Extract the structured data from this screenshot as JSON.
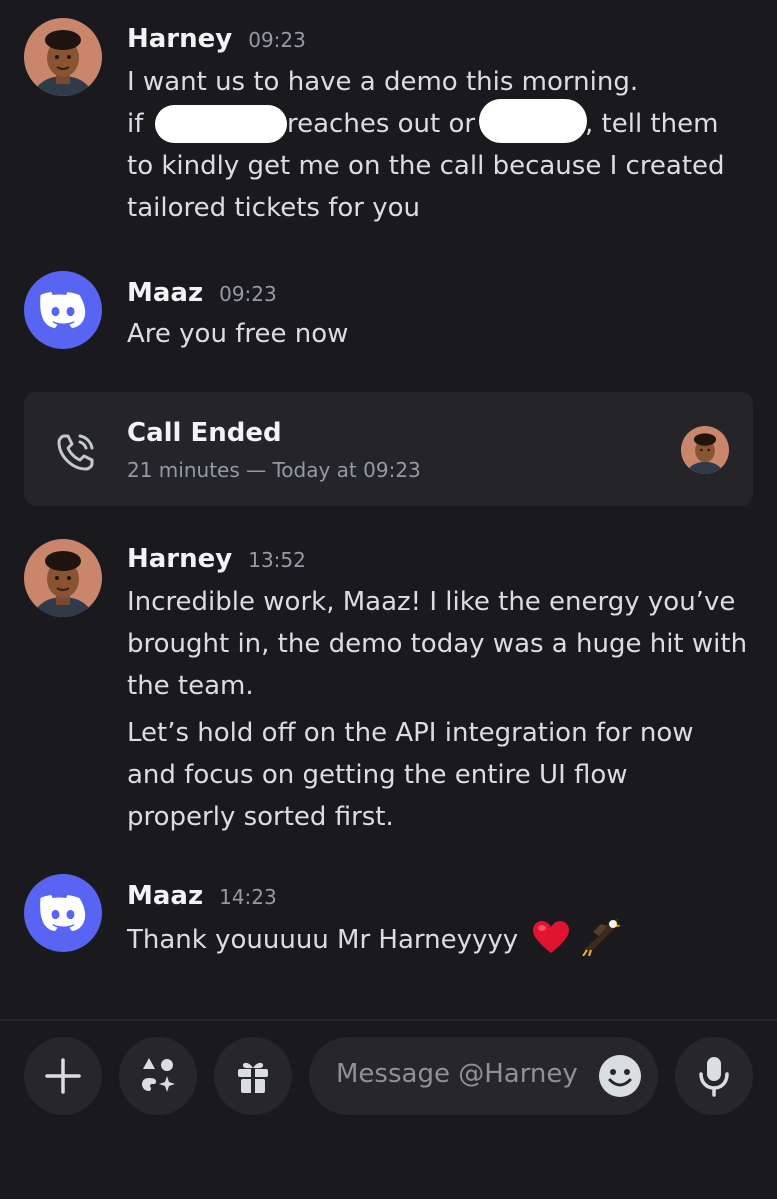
{
  "messages": [
    {
      "author": "Harney",
      "time": "09:23",
      "lines": [
        "I want us to have a demo this morning.",
        "if",
        "reaches out or",
        ", tell them",
        "to kindly get me on the call because I created",
        "tailored tickets for you"
      ]
    },
    {
      "author": "Maaz",
      "time": "09:23",
      "text": "Are you free now"
    },
    {
      "author": "Harney",
      "time": "13:52",
      "paragraph1": [
        "Incredible work, Maaz! I like the energy you’ve",
        "brought in, the demo today was a huge hit with",
        "the team."
      ],
      "paragraph2": [
        "Let’s hold off on the API integration for now",
        "and focus on getting the entire UI flow",
        "properly sorted first."
      ]
    },
    {
      "author": "Maaz",
      "time": "14:23",
      "text": "Thank youuuuu Mr Harneyyyy",
      "emoji": [
        "heart-emoji",
        "eagle-emoji"
      ]
    }
  ],
  "call": {
    "title": "Call Ended",
    "subtitle": "21 minutes — Today at 09:23",
    "icon": "phone-icon"
  },
  "composer": {
    "placeholder": "Message @Harney",
    "buttons": [
      "plus-icon",
      "apps-icon",
      "gift-icon",
      "emoji-icon",
      "microphone-icon"
    ]
  },
  "colors": {
    "background": "#1a1a1e",
    "discord_blurple": "#5865f2",
    "surface": "#26262b",
    "heart": "#e0142e"
  }
}
